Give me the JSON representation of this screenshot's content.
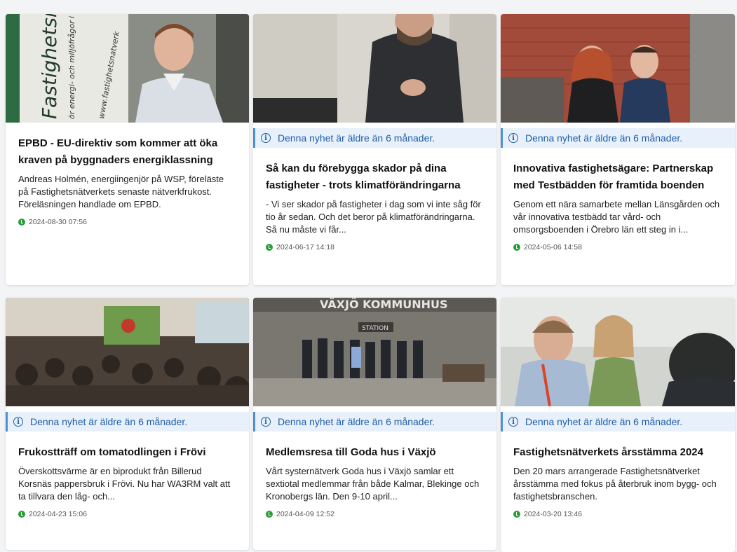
{
  "notice_text": "Denna nyhet är äldre än 6 månader.",
  "colors": {
    "notice_bg": "#e8f1fb",
    "notice_border": "#4a90d9",
    "notice_text": "#1e5da8",
    "clock": "#2a9d3b"
  },
  "image_text": {
    "banner_1": "Fastighetsnätv",
    "banner_2": "ör energi- och miljöfrågor i",
    "banner_3": "www.fastighetsnatverk",
    "sign_top": "VÄXJÖ KOMMUNHUS",
    "sign_station": "STATION"
  },
  "articles": [
    {
      "title": "EPBD - EU-direktiv som kommer att öka kraven på byggnaders energiklassning",
      "excerpt": "Andreas Holmén, energiingenjör på WSP, föreläste på Fastighetsnätverkets senaste nätverkfrukost. Föreläsningen handlade om EPBD.",
      "date": "2024-08-30 07:56",
      "notice": false
    },
    {
      "title": "Så kan du förebygga skador på dina fastigheter - trots klimatförändringarna",
      "excerpt": "- Vi ser skador på fastigheter i dag som vi inte såg för tio år sedan. Och det beror på klimatförändringarna. Så nu måste vi får...",
      "date": "2024-06-17 14:18",
      "notice": true
    },
    {
      "title": "Innovativa fastighetsägare: Partnerskap med Testbädden för framtida boenden",
      "excerpt": "Genom ett nära samarbete mellan Länsgården och vår innovativa testbädd tar vård- och omsorgsboenden i Örebro län ett steg in i...",
      "date": "2024-05-06 14:58",
      "notice": true
    },
    {
      "title": "Frukostträff om tomatodlingen i Frövi",
      "excerpt": "Överskottsvärme är en biprodukt från Billerud Korsnäs pappersbruk i Frövi. Nu har WA3RM valt att ta tillvara den låg- och...",
      "date": "2024-04-23 15:06",
      "notice": true
    },
    {
      "title": "Medlemsresa till Goda hus i Växjö",
      "excerpt": "Vårt systernätverk Goda hus i Växjö samlar ett sextiotal medlemmar från både Kalmar, Blekinge och Kronobergs län. Den 9-10 april...",
      "date": "2024-04-09 12:52",
      "notice": true
    },
    {
      "title": "Fastighetsnätverkets årsstämma 2024",
      "excerpt": "Den 20 mars arrangerade Fastighetsnätverket årsstämma med fokus på återbruk inom bygg- och fastighetsbranschen.",
      "date": "2024-03-20 13:46",
      "notice": true
    }
  ]
}
